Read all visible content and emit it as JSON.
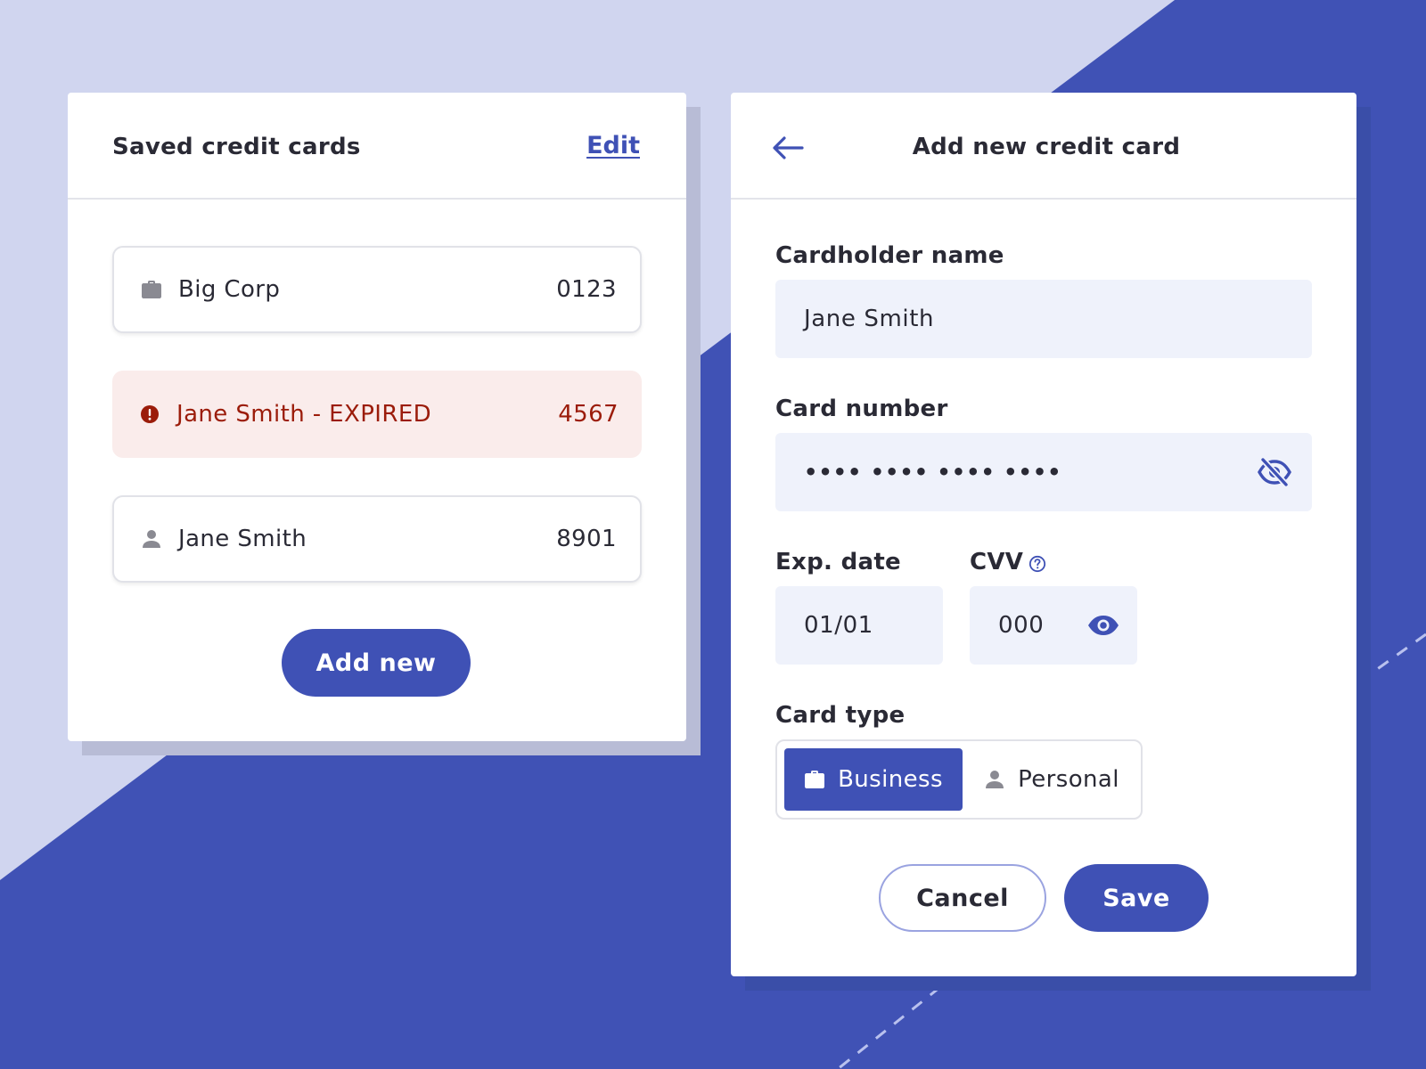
{
  "colors": {
    "accent": "#3f51b5",
    "background_light": "#d0d5ef",
    "background_dark": "#4052b5",
    "expired_bg": "#faeceb",
    "expired_text": "#9b1c0a",
    "field_bg": "#eff2fb"
  },
  "saved_cards": {
    "title": "Saved credit cards",
    "edit_label": "Edit",
    "cards": [
      {
        "icon": "briefcase-icon",
        "name": "Big Corp",
        "last_digits": "0123",
        "status": "normal"
      },
      {
        "icon": "alert-icon",
        "name": "Jane Smith - EXPIRED",
        "last_digits": "4567",
        "status": "expired"
      },
      {
        "icon": "person-icon",
        "name": "Jane Smith",
        "last_digits": "8901",
        "status": "normal"
      }
    ],
    "add_new_label": "Add new"
  },
  "new_card": {
    "back_icon": "arrow-left-icon",
    "title": "Add new credit card",
    "cardholder": {
      "label": "Cardholder name",
      "value": "Jane Smith"
    },
    "card_number": {
      "label": "Card number",
      "value": "•••• •••• •••• ••••",
      "icon": "eye-off-icon"
    },
    "exp_date": {
      "label": "Exp. date",
      "value": "01/01"
    },
    "cvv": {
      "label": "CVV",
      "value": "000",
      "icon": "eye-icon",
      "help_icon": "help-icon"
    },
    "card_type": {
      "label": "Card type",
      "options": [
        {
          "icon": "briefcase-icon",
          "label": "Business",
          "selected": true
        },
        {
          "icon": "person-icon",
          "label": "Personal",
          "selected": false
        }
      ]
    },
    "cancel_label": "Cancel",
    "save_label": "Save"
  }
}
